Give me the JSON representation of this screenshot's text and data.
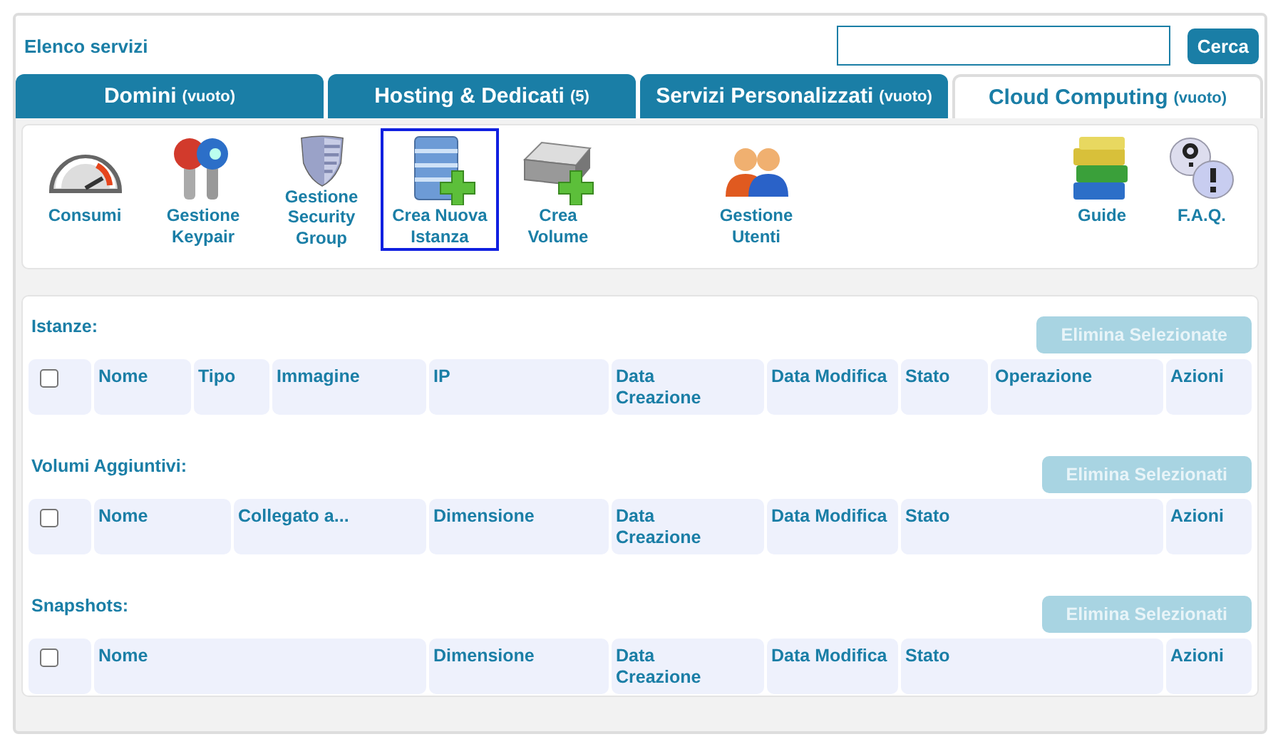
{
  "header": {
    "title": "Elenco servizi",
    "search_button": "Cerca"
  },
  "tabs": [
    {
      "label": "Domini",
      "count": "(vuoto)",
      "selected": false
    },
    {
      "label": "Hosting & Dedicati",
      "count": "(5)",
      "selected": false
    },
    {
      "label": "Servizi Personalizzati",
      "count": "(vuoto)",
      "selected": false
    },
    {
      "label": "Cloud Computing",
      "count": "(vuoto)",
      "selected": true
    }
  ],
  "toolbar": {
    "groups": [
      {
        "items": [
          {
            "kind": "gauge",
            "label": "Consumi",
            "selected": false
          },
          {
            "kind": "keys",
            "label": "Gestione Keypair",
            "selected": false
          },
          {
            "kind": "shield",
            "label": "Gestione Security Group",
            "selected": false
          },
          {
            "kind": "server",
            "label": "Crea Nuova Istanza",
            "selected": true
          },
          {
            "kind": "drive",
            "label": "Crea Volume",
            "selected": false
          }
        ]
      },
      {
        "items": [
          {
            "kind": "users",
            "label": "Gestione Utenti",
            "selected": false
          }
        ]
      },
      {
        "items": [
          {
            "kind": "books",
            "label": "Guide",
            "selected": false
          },
          {
            "kind": "faq",
            "label": "F.A.Q.",
            "selected": false
          }
        ]
      }
    ]
  },
  "sections": [
    {
      "title": "Istanze:",
      "button": "Elimina Selezionate",
      "columns": [
        "Nome",
        "Tipo",
        "Immagine",
        "IP",
        "Data Creazione",
        "Data Modifica",
        "Stato",
        "Operazione",
        "Azioni"
      ],
      "checked": false
    },
    {
      "title": "Volumi Aggiuntivi:",
      "button": "Elimina Selezionati",
      "columns": [
        "Nome",
        "Collegato a...",
        "Dimensione",
        "Data Creazione",
        "Data Modifica",
        "Stato",
        "Azioni"
      ],
      "checked": false
    },
    {
      "title": "Snapshots:",
      "button": "Elimina Selezionati",
      "columns": [
        "Nome",
        "Dimensione",
        "Data Creazione",
        "Data Modifica",
        "Stato",
        "Azioni"
      ],
      "checked": false
    }
  ]
}
